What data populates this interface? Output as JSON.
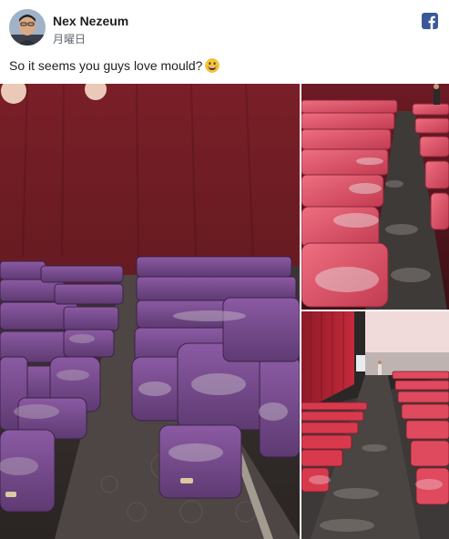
{
  "post": {
    "author": "Nex Nezeum",
    "timestamp": "月曜日",
    "caption": "So it seems you guys love mould?",
    "emoji": "grinning-face-emoji",
    "platform_icon": "facebook-icon"
  },
  "colors": {
    "seat_purple": "#7a4a8f",
    "seat_red": "#d8455a",
    "wall_red": "#9b2a38",
    "facebook_blue": "#3b5998"
  }
}
